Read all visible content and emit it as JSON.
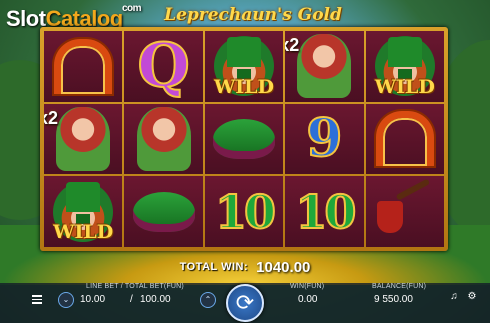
{
  "watermark": {
    "brand_part1": "Slot",
    "brand_part2": "Catalog",
    "suffix": "com"
  },
  "game_title": "Leprechaun's Gold",
  "reels": [
    [
      {
        "symbol": "horseshoe"
      },
      {
        "symbol": "girl",
        "multiplier": "x2"
      },
      {
        "symbol": "leprechaun-wild",
        "wild": "WILD"
      }
    ],
    [
      {
        "symbol": "Q",
        "text": "Q"
      },
      {
        "symbol": "girl"
      },
      {
        "symbol": "shoe"
      }
    ],
    [
      {
        "symbol": "leprechaun-wild",
        "wild": "WILD"
      },
      {
        "symbol": "shoe"
      },
      {
        "symbol": "ten",
        "text": "10"
      }
    ],
    [
      {
        "symbol": "girl",
        "multiplier": "x2"
      },
      {
        "symbol": "nine",
        "text": "9"
      },
      {
        "symbol": "ten",
        "text": "10"
      }
    ],
    [
      {
        "symbol": "leprechaun-wild",
        "wild": "WILD"
      },
      {
        "symbol": "horseshoe"
      },
      {
        "symbol": "pipe"
      }
    ]
  ],
  "total_win": {
    "label": "TOTAL WIN:",
    "value": "1040.00"
  },
  "bottom_bar": {
    "bet_label": "LINE BET / TOTAL BET(FUN)",
    "line_bet": "10.00",
    "separator": "/",
    "total_bet": "100.00",
    "win_label": "WIN(FUN)",
    "win_value": "0.00",
    "balance_label": "BALANCE(FUN)",
    "balance_value": "9 550.00"
  },
  "icons": {
    "menu": "menu-icon",
    "bet_down": "chevron-down-icon",
    "bet_up": "chevron-up-icon",
    "spin": "spin-icon",
    "sound": "sound-icon",
    "settings": "settings-icon"
  }
}
